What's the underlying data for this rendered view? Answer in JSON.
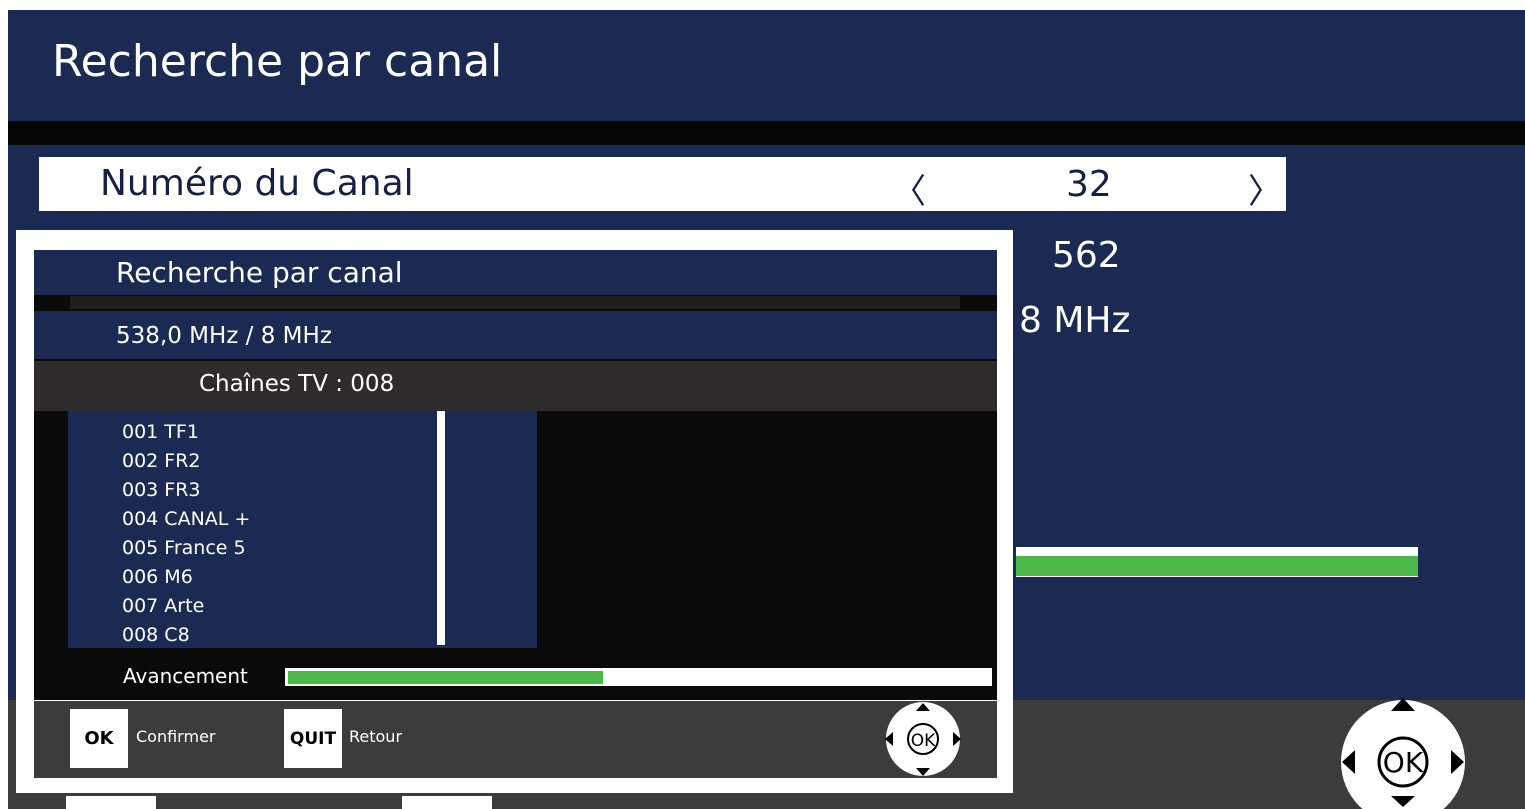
{
  "screen": {
    "title": "Recherche par canal",
    "channel": {
      "label": "Numéro du Canal",
      "value": "32",
      "left_arrow": "〈",
      "right_arrow": "〉"
    },
    "background_values": [
      "562",
      "8 MHz"
    ],
    "background_progress": 1.0
  },
  "dialog": {
    "title": "Recherche par canal",
    "frequency": "538,0 MHz / 8 MHz",
    "count": "Chaînes TV : 008",
    "channels": [
      "001 TF1",
      "002 FR2",
      "003 FR3",
      "004 CANAL +",
      "005 France 5",
      "006 M6",
      "007 Arte",
      "008 C8"
    ],
    "progress_label": "Avancement",
    "progress": 0.45,
    "footer": {
      "ok_key": "OK",
      "ok_label": "Confirmer",
      "quit_key": "QUIT",
      "quit_label": "Retour",
      "dpad_icon": "dpad-ok-icon"
    }
  },
  "colors": {
    "navy": "#1a2a52",
    "progress_green": "#4cb848",
    "footer_gray": "#3c3c3c"
  }
}
